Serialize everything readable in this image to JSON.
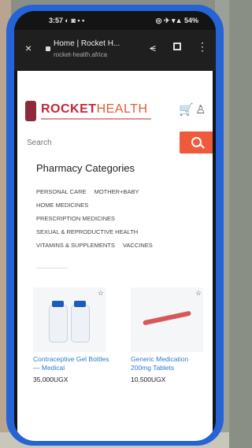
{
  "status_bar": {
    "time": "3:57 ◐ ◙ ▪ •",
    "indicators": "◎ ✈ ▾▲ 54%"
  },
  "browser": {
    "close_label": "×",
    "tab_title": "Home | Rocket H...",
    "url": "rocket-health.africa",
    "share_label": "⪪",
    "more_label": "⋮"
  },
  "site": {
    "logo": {
      "part1": "ROCKET",
      "part2": "HEALTH"
    },
    "cart_icon": "shopping-cart-icon",
    "user_icon": "user-icon",
    "search": {
      "placeholder": "Search"
    },
    "accent_color": "#ef5a3d"
  },
  "pharmacy": {
    "title": "Pharmacy Categories",
    "categories": [
      "PERSONAL CARE",
      "MOTHER+BABY",
      "HOME MEDICINES",
      "PRESCRIPTION MEDICINES",
      "SEXUAL & REPRODUCTIVE HEALTH",
      "VITAMINS & SUPPLEMENTS",
      "VACCINES"
    ]
  },
  "products": [
    {
      "name": "Contraceptive Gel Bottles — Medical",
      "price": "35,000UGX"
    },
    {
      "name": "Generic Medication 200mg Tablets",
      "price": "10,500UGX"
    }
  ]
}
